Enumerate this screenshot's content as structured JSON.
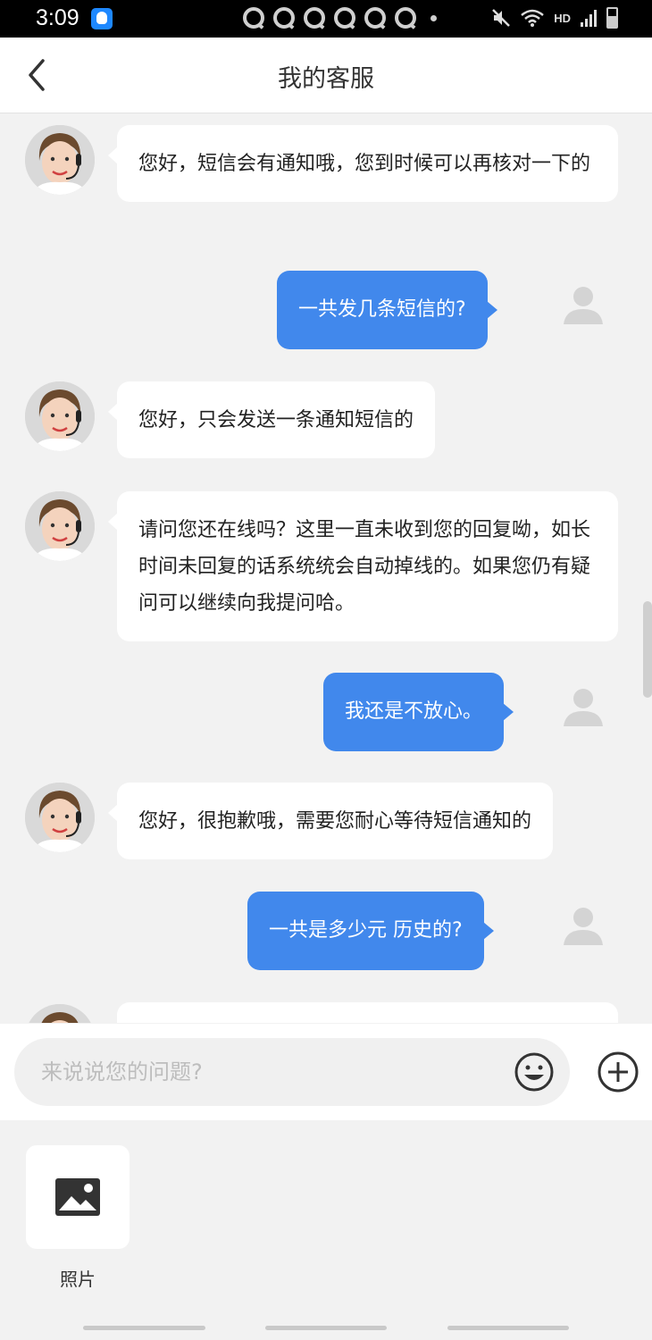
{
  "status_bar": {
    "time": "3:09",
    "network": "HD",
    "icons": [
      "app-notification-icon",
      "notification-icon",
      "notification-icon",
      "notification-icon",
      "notification-icon",
      "notification-icon",
      "notification-icon",
      "more-dot-icon",
      "mute-icon",
      "wifi-icon",
      "signal-icon",
      "battery-icon"
    ]
  },
  "header": {
    "title": "我的客服",
    "back_icon": "chevron-left-icon"
  },
  "messages": [
    {
      "sender": "agent",
      "text": "您好，短信会有通知哦，您到时候可以再核对一下的"
    },
    {
      "sender": "user",
      "text": "一共发几条短信的?"
    },
    {
      "sender": "agent",
      "text": "您好，只会发送一条通知短信的"
    },
    {
      "sender": "agent",
      "text": "请问您还在线吗？这里一直未收到您的回复呦，如长时间未回复的话系统统会自动掉线的。如果您仍有疑问可以继续向我提问哈。"
    },
    {
      "sender": "user",
      "text": "我还是不放心。"
    },
    {
      "sender": "agent",
      "text": "您好，很抱歉哦，需要您耐心等待短信通知的"
    },
    {
      "sender": "user",
      "text": "一共是多少元 历史的?"
    },
    {
      "sender": "agent",
      "text": ""
    }
  ],
  "input": {
    "placeholder": "来说说您的问题?",
    "value": "",
    "emoji_icon": "emoji-icon",
    "plus_icon": "plus-circle-icon"
  },
  "tools": [
    {
      "label": "照片",
      "icon": "image-icon"
    }
  ],
  "colors": {
    "user_bubble": "#4188ec",
    "agent_bubble": "#ffffff",
    "background": "#f2f2f2"
  }
}
